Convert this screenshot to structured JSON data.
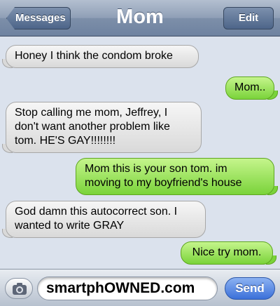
{
  "navbar": {
    "title": "Mom",
    "back_label": "Messages",
    "edit_label": "Edit"
  },
  "messages": [
    {
      "direction": "received",
      "text": "Honey I think the condom broke"
    },
    {
      "direction": "sent",
      "text": "Mom.."
    },
    {
      "direction": "received",
      "text": "Stop calling me mom, Jeffrey, I don't want another problem like tom. HE'S GAY!!!!!!!!"
    },
    {
      "direction": "sent",
      "text": "Mom this is your son tom. im moving to my boyfriend's house"
    },
    {
      "direction": "received",
      "text": "God damn this autocorrect son. I wanted to write GRAY"
    },
    {
      "direction": "sent",
      "text": "Nice try mom."
    }
  ],
  "composer": {
    "input_value": "smartphOWNED.com",
    "send_label": "Send",
    "camera_icon": "camera-icon"
  },
  "colors": {
    "received_bubble": "#e6e6e6",
    "sent_bubble": "#8fdc4b",
    "send_button": "#4a7fe0",
    "background": "#dbe2ed"
  }
}
